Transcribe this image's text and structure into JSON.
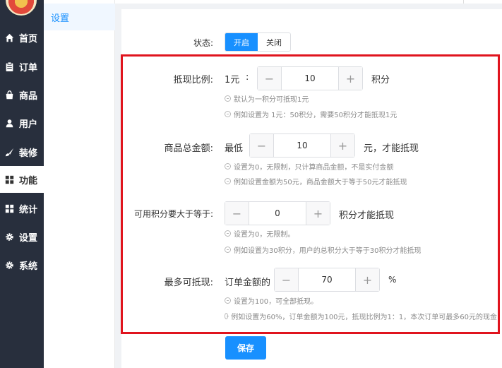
{
  "sidebar": {
    "items": [
      {
        "label": "首页",
        "icon": "home-icon"
      },
      {
        "label": "订单",
        "icon": "clipboard-icon"
      },
      {
        "label": "商品",
        "icon": "shopping-bag-icon"
      },
      {
        "label": "用户",
        "icon": "user-icon"
      },
      {
        "label": "装修",
        "icon": "brush-icon"
      },
      {
        "label": "功能",
        "icon": "grid-icon"
      },
      {
        "label": "统计",
        "icon": "grid-icon"
      },
      {
        "label": "设置",
        "icon": "gear-icon"
      },
      {
        "label": "系统",
        "icon": "gear-icon"
      }
    ],
    "active": "功能"
  },
  "submenu": {
    "item": "设置"
  },
  "form": {
    "status": {
      "label": "状态:",
      "on": "开启",
      "off": "关闭",
      "selected": "开启"
    },
    "ratio": {
      "label": "抵现比例:",
      "prefix": "1元",
      "colon": ":",
      "value": "10",
      "suffix": "积分",
      "hint1": "默认为一积分可抵现1元",
      "hint2": "例如设置为 1元：50积分，需要50积分才能抵现1元"
    },
    "min_total": {
      "label": "商品总金额:",
      "prefix": "最低",
      "value": "10",
      "suffix": "元，才能抵现",
      "hint1": "设置为0，无限制，只计算商品金额，不是实付金额",
      "hint2": "例如设置金额为50元，商品金额大于等于50元才能抵现"
    },
    "min_points": {
      "label": "可用积分要大于等于:",
      "value": "0",
      "suffix": "积分才能抵现",
      "hint1": "设置为0，无限制。",
      "hint2": "例如设置为30积分，用户的总积分大于等于30积分才能抵现"
    },
    "max_deduct": {
      "label": "最多可抵现:",
      "prefix": "订单金额的",
      "value": "70",
      "suffix": "%",
      "hint1": "设置为100，可全部抵现。",
      "hint2": "例如设置为60%，订单金额为100元，抵现比例为1：1，本次订单可最多60元的现金"
    },
    "save_label": "保存"
  },
  "colors": {
    "sidebar": "#282f3d",
    "accent": "#1890ff",
    "highlight_box": "#e0141e"
  }
}
